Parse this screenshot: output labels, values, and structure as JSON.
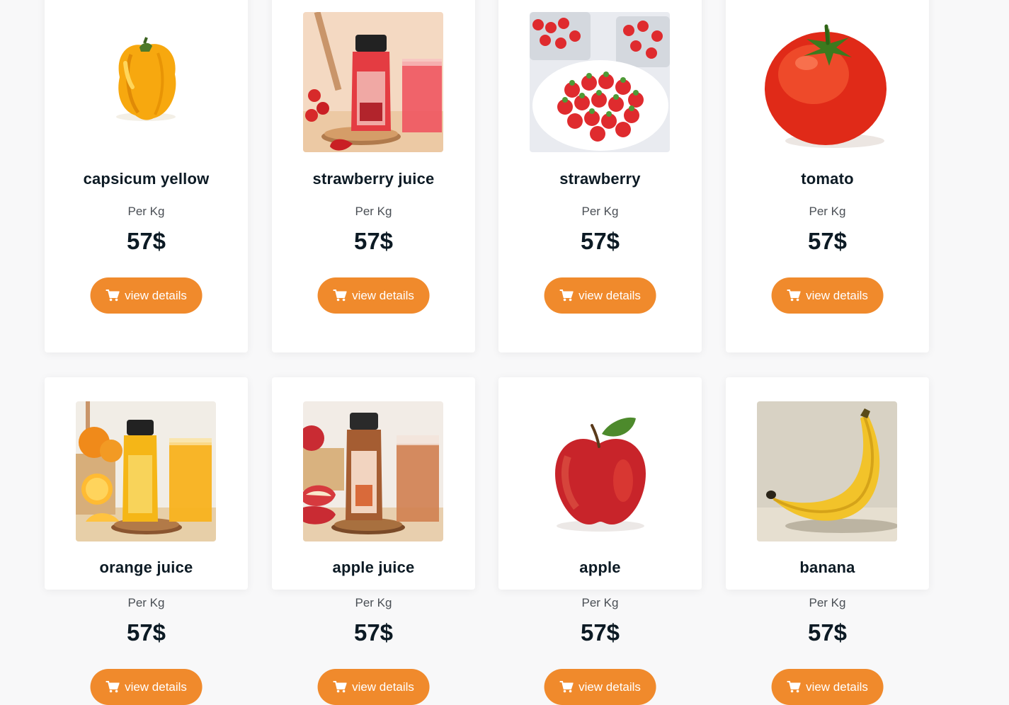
{
  "colors": {
    "accent": "#f08a2c",
    "title": "#0c1a24",
    "unit": "#4a4f55"
  },
  "button_icon": "cart-icon",
  "products": [
    {
      "name": "capsicum yellow",
      "unit": "Per Kg",
      "price": "57$",
      "button": "view details",
      "image": "yellow-bell-pepper"
    },
    {
      "name": "strawberry juice",
      "unit": "Per Kg",
      "price": "57$",
      "button": "view details",
      "image": "strawberry-juice-bottle"
    },
    {
      "name": "strawberry",
      "unit": "Per Kg",
      "price": "57$",
      "button": "view details",
      "image": "strawberries-plate"
    },
    {
      "name": "tomato",
      "unit": "Per Kg",
      "price": "57$",
      "button": "view details",
      "image": "red-tomato"
    },
    {
      "name": "orange juice",
      "unit": "Per Kg",
      "price": "57$",
      "button": "view details",
      "image": "orange-juice-bottle"
    },
    {
      "name": "apple juice",
      "unit": "Per Kg",
      "price": "57$",
      "button": "view details",
      "image": "apple-juice-bottle"
    },
    {
      "name": "apple",
      "unit": "Per Kg",
      "price": "57$",
      "button": "view details",
      "image": "red-apple"
    },
    {
      "name": "banana",
      "unit": "Per Kg",
      "price": "57$",
      "button": "view details",
      "image": "banana"
    }
  ]
}
